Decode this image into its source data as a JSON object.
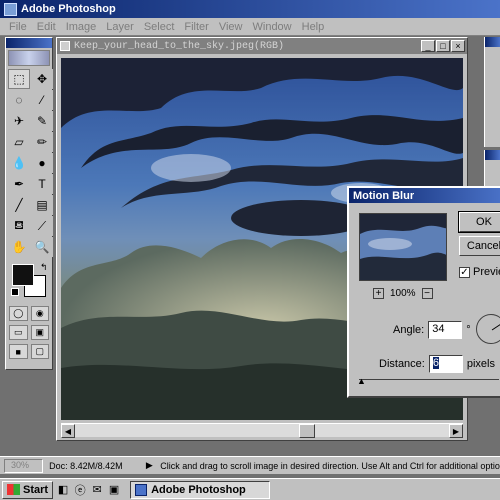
{
  "app": {
    "title": "Adobe Photoshop"
  },
  "menu": [
    "File",
    "Edit",
    "Image",
    "Layer",
    "Select",
    "Filter",
    "View",
    "Window",
    "Help"
  ],
  "document": {
    "title": "Keep_your_head_to_the_sky.jpeg(RGB)",
    "buttons": [
      "_",
      "□",
      "×"
    ]
  },
  "tools": [
    {
      "name": "marquee-tool",
      "glyph": "⬚"
    },
    {
      "name": "move-tool",
      "glyph": "✥"
    },
    {
      "name": "lasso-tool",
      "glyph": "◌"
    },
    {
      "name": "magic-wand-tool",
      "glyph": "⁄"
    },
    {
      "name": "airbrush-tool",
      "glyph": "✈"
    },
    {
      "name": "paintbrush-tool",
      "glyph": "✎"
    },
    {
      "name": "eraser-tool",
      "glyph": "▱"
    },
    {
      "name": "pencil-tool",
      "glyph": "✏"
    },
    {
      "name": "blur-tool",
      "glyph": "💧"
    },
    {
      "name": "burn-tool",
      "glyph": "●"
    },
    {
      "name": "pen-tool",
      "glyph": "✒"
    },
    {
      "name": "type-tool",
      "glyph": "T"
    },
    {
      "name": "line-tool",
      "glyph": "╱"
    },
    {
      "name": "gradient-tool",
      "glyph": "▤"
    },
    {
      "name": "paint-bucket-tool",
      "glyph": "⛾"
    },
    {
      "name": "eyedropper-tool",
      "glyph": "⟋"
    },
    {
      "name": "hand-tool",
      "glyph": "✋"
    },
    {
      "name": "zoom-tool",
      "glyph": "🔍"
    }
  ],
  "dialog": {
    "title": "Motion Blur",
    "ok_label": "OK",
    "cancel_label": "Cancel",
    "preview_label": "Preview",
    "preview_checked": true,
    "zoom_plus": "+",
    "zoom_level": "100%",
    "zoom_minus": "−",
    "angle_label": "Angle:",
    "angle_value": "34",
    "angle_unit": "°",
    "distance_label": "Distance:",
    "distance_value": "6",
    "distance_unit": "pixels"
  },
  "status": {
    "zoom": "30%",
    "doc_size": "Doc: 8.42M/8.42M",
    "message": "Click and drag to scroll image in desired direction. Use Alt and Ctrl for additional options"
  },
  "taskbar": {
    "start_label": "Start",
    "task_label": "Adobe Photoshop"
  },
  "colors": {
    "title_blue": "#0a246a",
    "chrome_gray": "#c0c0c0"
  }
}
